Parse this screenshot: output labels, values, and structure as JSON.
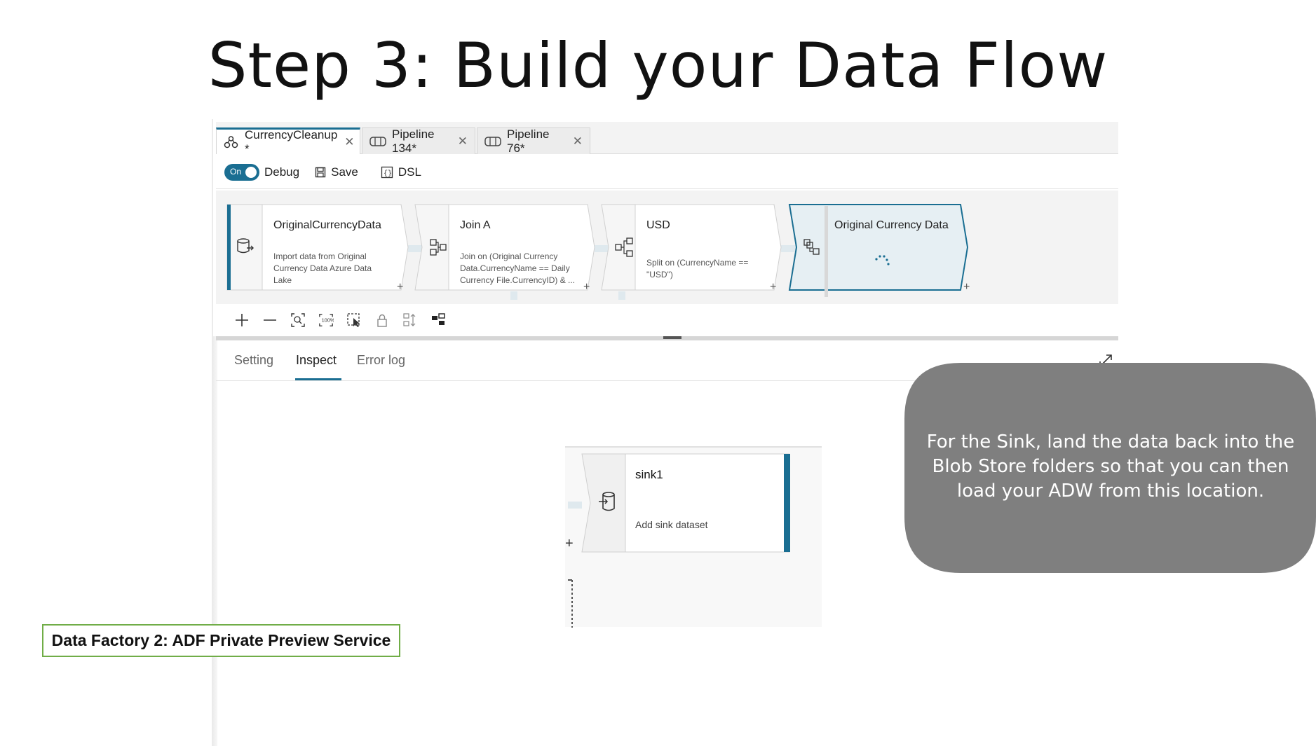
{
  "slide": {
    "title": "Step 3: Build your Data Flow",
    "footer_label": "Data Factory 2: ADF Private Preview Service"
  },
  "tabs": [
    {
      "label": "CurrencyCleanup *",
      "icon": "dataflow-icon",
      "active": true
    },
    {
      "label": "Pipeline 134*",
      "icon": "pipeline-icon",
      "active": false
    },
    {
      "label": "Pipeline 76*",
      "icon": "pipeline-icon",
      "active": false
    }
  ],
  "toolbar": {
    "debug_toggle": "On",
    "debug_label": "Debug",
    "save_label": "Save",
    "dsl_label": "DSL"
  },
  "nodes": [
    {
      "title": "OriginalCurrencyData",
      "desc": [
        "Import data from Original",
        "Currency Data Azure Data",
        "Lake"
      ],
      "icon": "source-icon"
    },
    {
      "title": "Join A",
      "desc": [
        "Join on (Original Currency",
        "Data.CurrencyName == Daily",
        "Currency File.CurrencyID) & ..."
      ],
      "icon": "join-icon"
    },
    {
      "title": "USD",
      "desc": [
        "Split on (CurrencyName ==",
        "\"USD\")"
      ],
      "icon": "split-icon"
    },
    {
      "title": "Original Currency Data",
      "desc": [],
      "icon": "derived-icon",
      "selected": true
    }
  ],
  "panel_tabs": [
    {
      "label": "Setting",
      "active": false
    },
    {
      "label": "Inspect",
      "active": true
    },
    {
      "label": "Error log",
      "active": false
    }
  ],
  "sink": {
    "title": "sink1",
    "desc": "Add sink dataset",
    "icon": "sink-icon"
  },
  "callout": {
    "text": "For the Sink, land the data back into the Blob Store folders so that you can then load your ADW from this location."
  },
  "colors": {
    "accent": "#1a6e92",
    "callout_bg": "#7f7f7f",
    "footer_border": "#70ad47",
    "selected_node_bg": "#e6eff3"
  }
}
